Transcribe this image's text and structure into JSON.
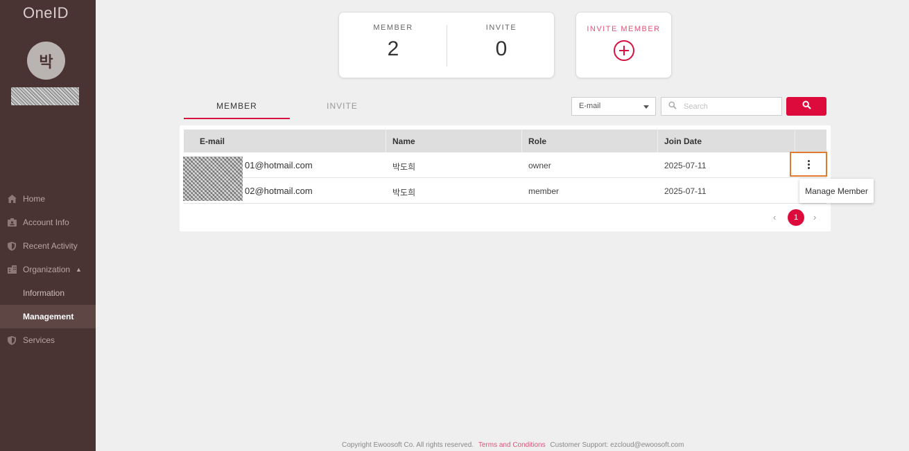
{
  "sidebar": {
    "logo": "OneID",
    "avatar_initial": "박",
    "nav": [
      {
        "label": "Home",
        "icon": "home-icon"
      },
      {
        "label": "Account Info",
        "icon": "id-card-icon"
      },
      {
        "label": "Recent Activity",
        "icon": "shield-icon"
      },
      {
        "label": "Organization",
        "icon": "building-icon"
      },
      {
        "label": "Information"
      },
      {
        "label": "Management"
      },
      {
        "label": "Services",
        "icon": "shield-icon"
      }
    ]
  },
  "stats": {
    "member_label": "MEMBER",
    "member_count": "2",
    "invite_label": "INVITE",
    "invite_count": "0",
    "invite_member_label": "INVITE MEMBER"
  },
  "tabs": [
    {
      "label": "MEMBER",
      "active": true
    },
    {
      "label": "INVITE",
      "active": false
    }
  ],
  "filter": {
    "select_value": "E-mail",
    "search_placeholder": "Search"
  },
  "table": {
    "headers": [
      "E-mail",
      "Name",
      "Role",
      "Join Date"
    ],
    "rows": [
      {
        "email": "01@hotmail.com",
        "name": "박도희",
        "role": "owner",
        "join_date": "2025-07-11"
      },
      {
        "email": "02@hotmail.com",
        "name": "박도희",
        "role": "member",
        "join_date": "2025-07-11"
      }
    ]
  },
  "row_menu": {
    "item": "Manage Member"
  },
  "pagination": {
    "prev": "‹",
    "current": "1",
    "next": "›"
  },
  "footer": {
    "copyright": "Copyright Ewoosoft Co. All rights reserved.",
    "terms": "Terms and Conditions",
    "support": "Customer Support: ezcloud@ewoosoft.com"
  },
  "colors": {
    "sidebar_bg": "#4a3433",
    "accent": "#dc0b3c",
    "highlight": "#e07a2e"
  }
}
